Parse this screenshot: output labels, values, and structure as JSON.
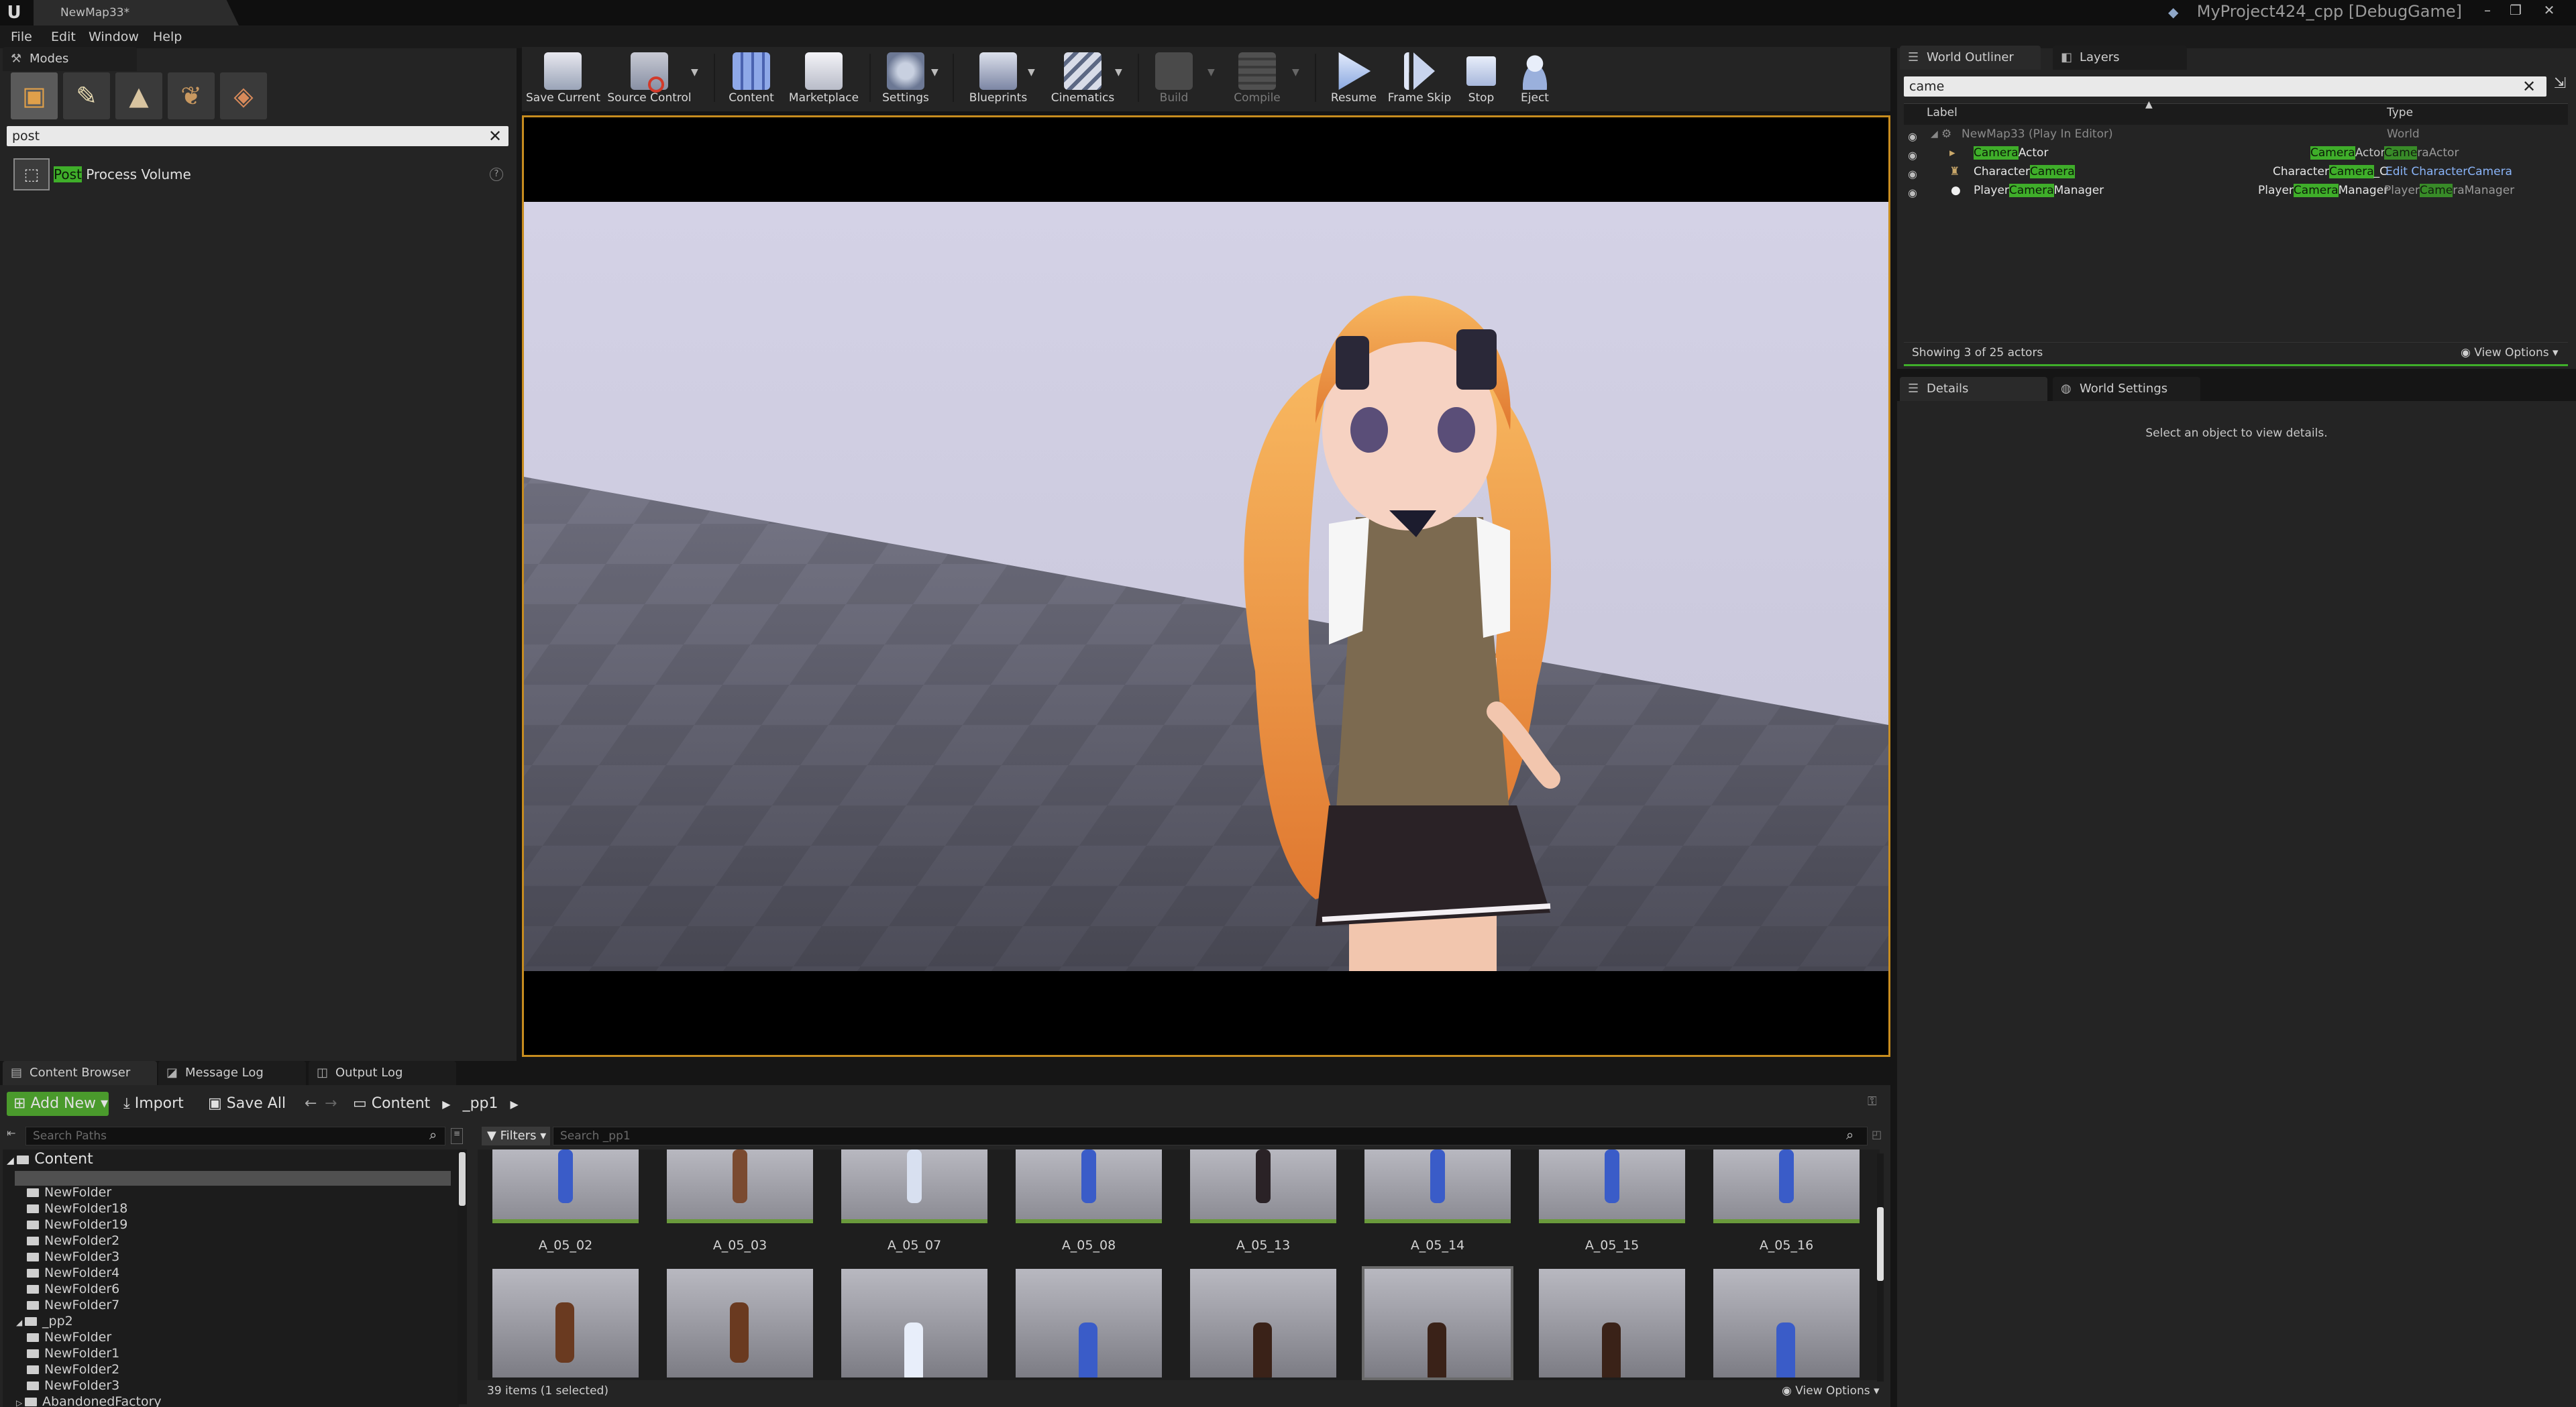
{
  "titlebar": {
    "doc_tab": "NewMap33*",
    "project": "MyProject424_cpp [DebugGame]"
  },
  "menu": [
    "File",
    "Edit",
    "Window",
    "Help"
  ],
  "modes": {
    "tab": "Modes",
    "search_value": "post",
    "result_prefix": "Post",
    "result_suffix": " Process Volume"
  },
  "toolbar": {
    "save": "Save Current",
    "source": "Source Control",
    "content": "Content",
    "marketplace": "Marketplace",
    "settings": "Settings",
    "blueprints": "Blueprints",
    "cinematics": "Cinematics",
    "build": "Build",
    "compile": "Compile",
    "resume": "Resume",
    "frameskip": "Frame Skip",
    "stop": "Stop",
    "eject": "Eject"
  },
  "outliner": {
    "tab": "World Outliner",
    "layers_tab": "Layers",
    "search_value": "came",
    "col_label": "Label",
    "col_type": "Type",
    "root_label": "NewMap33 (Play In Editor)",
    "root_type": "World",
    "r1": {
      "pre": "",
      "hl": "Camera",
      "post": "Actor",
      "type_hl": "Camera",
      "type_post": "Actor",
      "ctype_hl": "Came",
      "ctype_post": "raActor"
    },
    "r2": {
      "pre": "Character",
      "hl": "Camera",
      "post": "",
      "type_pre": "Character",
      "type_hl": "Camera",
      "type_post": "_C",
      "link_pre": "Edit Character",
      "link_hl": "Camera"
    },
    "r3": {
      "pre": "Player",
      "hl": "Camera",
      "post": "Manager",
      "type_pre": "Player",
      "type_hl": "Camera",
      "type_post": "Manager",
      "link_pre": "Player",
      "link_hl": "Came",
      "link_post": "raManager"
    },
    "footer": "Showing 3 of 25 actors",
    "view_options": "View Options"
  },
  "details": {
    "tab": "Details",
    "world_tab": "World Settings",
    "empty": "Select an object to view details."
  },
  "content_browser": {
    "tab": "Content Browser",
    "msg_tab": "Message Log",
    "out_tab": "Output Log",
    "add_new": "Add New",
    "import": "Import",
    "save_all": "Save All",
    "crumb_root": "Content",
    "crumb_leaf": "_pp1",
    "search_paths_placeholder": "Search Paths",
    "filters": "Filters",
    "search_placeholder": "Search _pp1",
    "tree_root": "Content",
    "folders_a": [
      "NewFolder",
      "NewFolder18",
      "NewFolder19",
      "NewFolder2",
      "NewFolder3",
      "NewFolder4",
      "NewFolder6",
      "NewFolder7"
    ],
    "pp2": "_pp2",
    "folders_b": [
      "NewFolder",
      "NewFolder1",
      "NewFolder2",
      "NewFolder3"
    ],
    "folder_last": "AbandonedFactory",
    "assets_row1": [
      "A_05_02",
      "A_05_03",
      "A_05_07",
      "A_05_08",
      "A_05_13",
      "A_05_14",
      "A_05_15",
      "A_05_16"
    ],
    "status": "39 items (1 selected)",
    "view_options": "View Options"
  },
  "colors": {
    "highlight": "#3fae2a",
    "viewport_border": "#c78c1f",
    "accent_green": "#4a9a2c",
    "link_blue": "#8ab4f8"
  }
}
